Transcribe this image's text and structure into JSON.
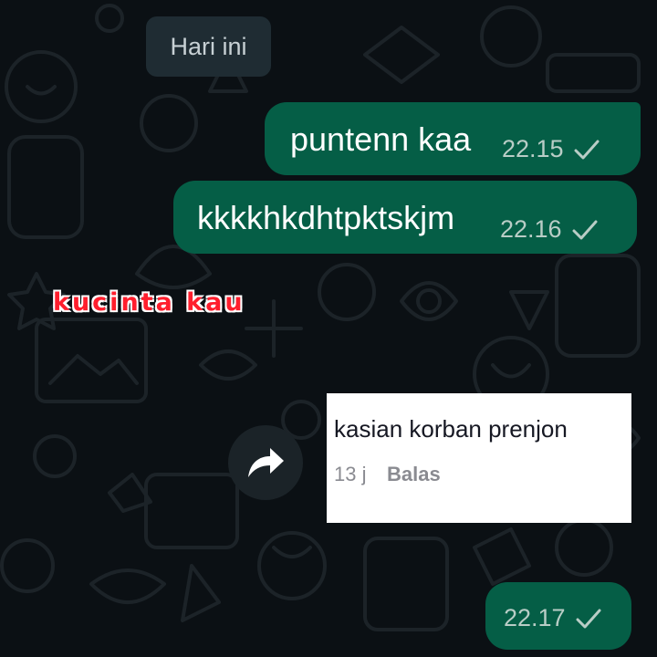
{
  "date_chip": "Hari ini",
  "messages": [
    {
      "text": "puntenn kaa",
      "time": "22.15",
      "status": "sent-check-icon"
    },
    {
      "text": "kkkkhkdhtpktskjm",
      "time": "22.16",
      "status": "sent-check-icon"
    },
    {
      "text": "",
      "time": "22.17",
      "status": "sent-check-icon"
    }
  ],
  "sticker_text": "kucinta kau",
  "comment": {
    "text": "kasian korban prenjon",
    "time": "13 j",
    "reply": "Balas"
  },
  "colors": {
    "background": "#0b1014",
    "bubble_out": "#055e46",
    "date_chip": "#1f2c33",
    "sticker_text": "#ff1e2d"
  }
}
